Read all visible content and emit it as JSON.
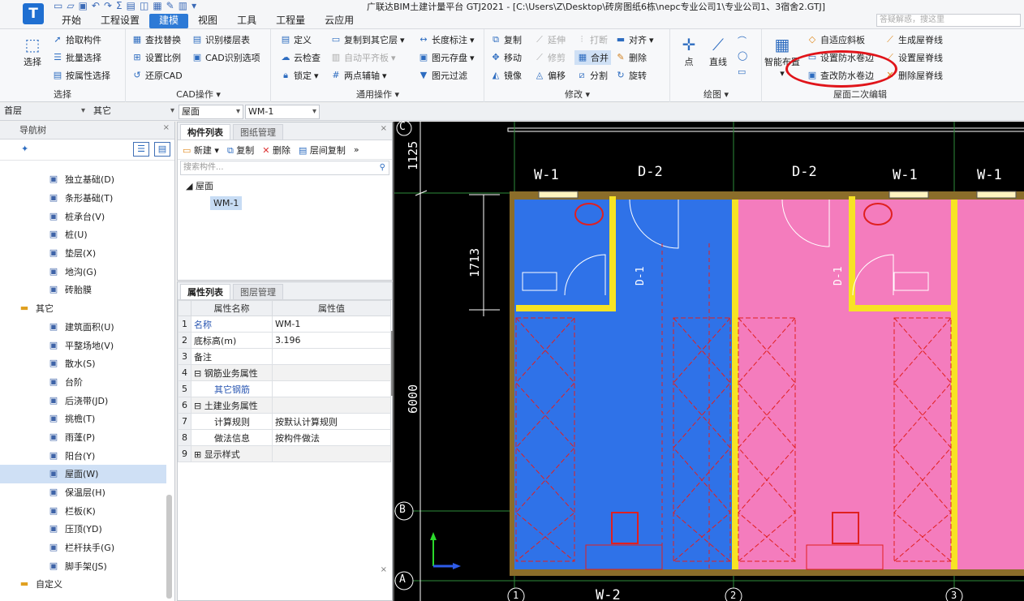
{
  "app": {
    "logo": "T",
    "title": "广联达BIM土建计量平台 GTJ2021 - [C:\\Users\\Z\\Desktop\\砖房图纸6栋\\nepc专业公司1\\专业公司1、3宿舍2.GTJ]",
    "search_placeholder": "答疑解惑，搜这里"
  },
  "menus": [
    "开始",
    "工程设置",
    "建模",
    "视图",
    "工具",
    "工程量",
    "云应用"
  ],
  "active_menu": "建模",
  "ribbon": {
    "select_group": {
      "label": "选择",
      "big": "选择",
      "items": [
        "拾取构件",
        "批量选择",
        "按属性选择"
      ]
    },
    "cad_group": {
      "label": "CAD操作",
      "items": [
        "查找替换",
        "识别楼层表",
        "设置比例",
        "CAD识别选项",
        "还原CAD"
      ]
    },
    "common_group": {
      "label": "通用操作",
      "items": [
        "定义",
        "复制到其它层",
        "长度标注",
        "云检查",
        "自动平齐板",
        "图元存盘",
        "锁定",
        "两点辅轴",
        "图元过滤"
      ]
    },
    "modify_group": {
      "label": "修改",
      "items": [
        "复制",
        "延伸",
        "打断",
        "对齐",
        "移动",
        "修剪",
        "合并",
        "删除",
        "镜像",
        "偏移",
        "分割",
        "旋转"
      ]
    },
    "draw_group": {
      "label": "绘图",
      "items": [
        "点",
        "直线"
      ]
    },
    "roof_group": {
      "label": "屋面二次编辑",
      "big": "智能布置",
      "items": [
        "自适应斜板",
        "生成屋脊线",
        "设置防水卷边",
        "设置屋脊线",
        "查改防水卷边",
        "删除屋脊线"
      ]
    }
  },
  "selectors": [
    "首层",
    "其它",
    "屋面",
    "WM-1"
  ],
  "nav": {
    "title": "导航树",
    "items": [
      {
        "icon": "foundation-icon",
        "label": "独立基础(D)"
      },
      {
        "icon": "strip-foundation-icon",
        "label": "条形基础(T)"
      },
      {
        "icon": "pile-cap-icon",
        "label": "桩承台(V)"
      },
      {
        "icon": "pile-icon",
        "label": "桩(U)"
      },
      {
        "icon": "cushion-icon",
        "label": "垫层(X)"
      },
      {
        "icon": "trench-icon",
        "label": "地沟(G)"
      },
      {
        "icon": "brick-mold-icon",
        "label": "砖胎膜"
      },
      {
        "icon": "folder-icon",
        "label": "其它",
        "group": true
      },
      {
        "icon": "area-icon",
        "label": "建筑面积(U)"
      },
      {
        "icon": "leveling-icon",
        "label": "平整场地(V)"
      },
      {
        "icon": "apron-icon",
        "label": "散水(S)"
      },
      {
        "icon": "step-icon",
        "label": "台阶"
      },
      {
        "icon": "post-cast-icon",
        "label": "后浇带(JD)"
      },
      {
        "icon": "cornice-icon",
        "label": "挑檐(T)"
      },
      {
        "icon": "canopy-icon",
        "label": "雨蓬(P)"
      },
      {
        "icon": "balcony-icon",
        "label": "阳台(Y)"
      },
      {
        "icon": "roof-icon",
        "label": "屋面(W)",
        "selected": true
      },
      {
        "icon": "insulation-icon",
        "label": "保温层(H)"
      },
      {
        "icon": "parapet-icon",
        "label": "栏板(K)"
      },
      {
        "icon": "coping-icon",
        "label": "压顶(YD)"
      },
      {
        "icon": "railing-icon",
        "label": "栏杆扶手(G)"
      },
      {
        "icon": "scaffold-icon",
        "label": "脚手架(JS)"
      },
      {
        "icon": "folder-icon",
        "label": "自定义",
        "group": true
      }
    ]
  },
  "component_list": {
    "tabs": [
      "构件列表",
      "图纸管理"
    ],
    "tools": [
      "新建",
      "复制",
      "删除",
      "层间复制"
    ],
    "search_placeholder": "搜索构件...",
    "tree_root": "屋面",
    "tree_leaf": "WM-1"
  },
  "properties": {
    "tabs": [
      "属性列表",
      "图层管理"
    ],
    "col_name": "属性名称",
    "col_value": "属性值",
    "rows": [
      {
        "n": "1",
        "name": "名称",
        "value": "WM-1",
        "blue": true
      },
      {
        "n": "2",
        "name": "底标高(m)",
        "value": "3.196"
      },
      {
        "n": "3",
        "name": "备注",
        "value": ""
      },
      {
        "n": "4",
        "name": "钢筋业务属性",
        "value": "",
        "section": true
      },
      {
        "n": "5",
        "name": "其它钢筋",
        "value": "",
        "blue": true,
        "indent": true
      },
      {
        "n": "6",
        "name": "土建业务属性",
        "value": "",
        "section": true
      },
      {
        "n": "7",
        "name": "计算规则",
        "value": "按默认计算规则",
        "indent": true
      },
      {
        "n": "8",
        "name": "做法信息",
        "value": "按构件做法",
        "indent": true
      },
      {
        "n": "9",
        "name": "显示样式",
        "value": "",
        "section": true,
        "plus": true
      }
    ]
  },
  "canvas": {
    "axis_rows": [
      "C",
      "B",
      "A"
    ],
    "axis_cols": [
      "1",
      "2",
      "3"
    ],
    "dims": [
      "1125",
      "1713",
      "6000"
    ],
    "labels": [
      "W-1",
      "D-2",
      "D-2",
      "W-1",
      "W-1",
      "D-1",
      "D-1",
      "W-2"
    ],
    "colors": {
      "blue_room": "#2f72e8",
      "pink_room": "#f47cbd",
      "wall": "#8b6d2a",
      "yellow": "#f7e324"
    }
  }
}
